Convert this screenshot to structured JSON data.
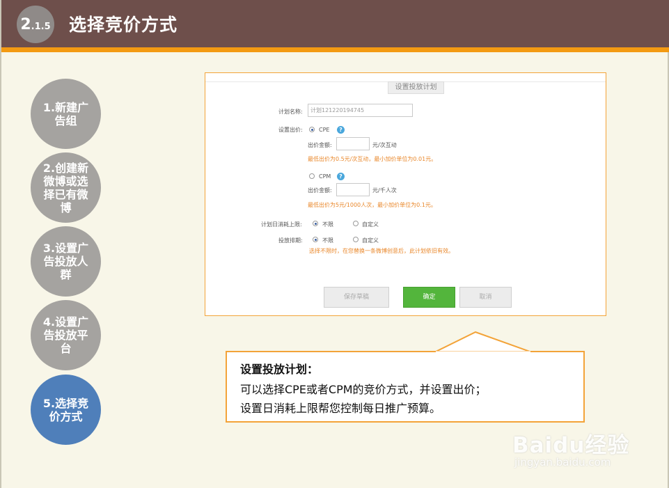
{
  "header": {
    "section_major": "2",
    "section_minor": ".1.5",
    "title": "选择竞价方式"
  },
  "steps": [
    {
      "label": "1.新建广告组",
      "active": false
    },
    {
      "label": "2.创建新微博或选择已有微博",
      "active": false
    },
    {
      "label": "3.设置广告投放人群",
      "active": false
    },
    {
      "label": "4.设置广告投放平台",
      "active": false
    },
    {
      "label": "5.选择竞价方式",
      "active": true
    }
  ],
  "form": {
    "tab_label": "设置投放计划",
    "plan_name_label": "计划名称:",
    "plan_name_value": "计划121220194745",
    "bid_label": "设置出价:",
    "cpe_option": "CPE",
    "cpe_amount_label": "出价金额:",
    "cpe_amount_value": "",
    "cpe_unit": "元/次互动",
    "cpe_hint": "最低出价为0.5元/次互动，最小加价单位为0.01元。",
    "cpm_option": "CPM",
    "cpm_amount_label": "出价金额:",
    "cpm_amount_value": "",
    "cpm_unit": "元/千人次",
    "cpm_hint": "最低出价为5元/1000人次，最小加价单位为0.1元。",
    "daily_limit_label": "计划日消耗上限:",
    "daily_limit_opt1": "不限",
    "daily_limit_opt2": "自定义",
    "schedule_label": "投放排期:",
    "schedule_opt1": "不限",
    "schedule_opt2": "自定义",
    "schedule_hint": "选择不限时，在您替换一条微博创意后，此计划依旧有效。",
    "save_draft": "保存草稿",
    "confirm": "确定",
    "cancel": "取消"
  },
  "callout": {
    "title": "设置投放计划：",
    "line1": "可以选择CPE或者CPM的竞价方式，并设置出价；",
    "line2": "设置日消耗上限帮您控制每日推广预算。"
  },
  "watermark": {
    "brand": "Baidu经验",
    "url": "jingyan.baidu.com"
  },
  "colors": {
    "header_bg": "#6e4f4b",
    "accent_orange": "#f39a12",
    "step_inactive": "#a5a3a0",
    "step_active": "#4f7fba",
    "confirm_green": "#53b53c",
    "hint_orange": "#e9872a"
  }
}
